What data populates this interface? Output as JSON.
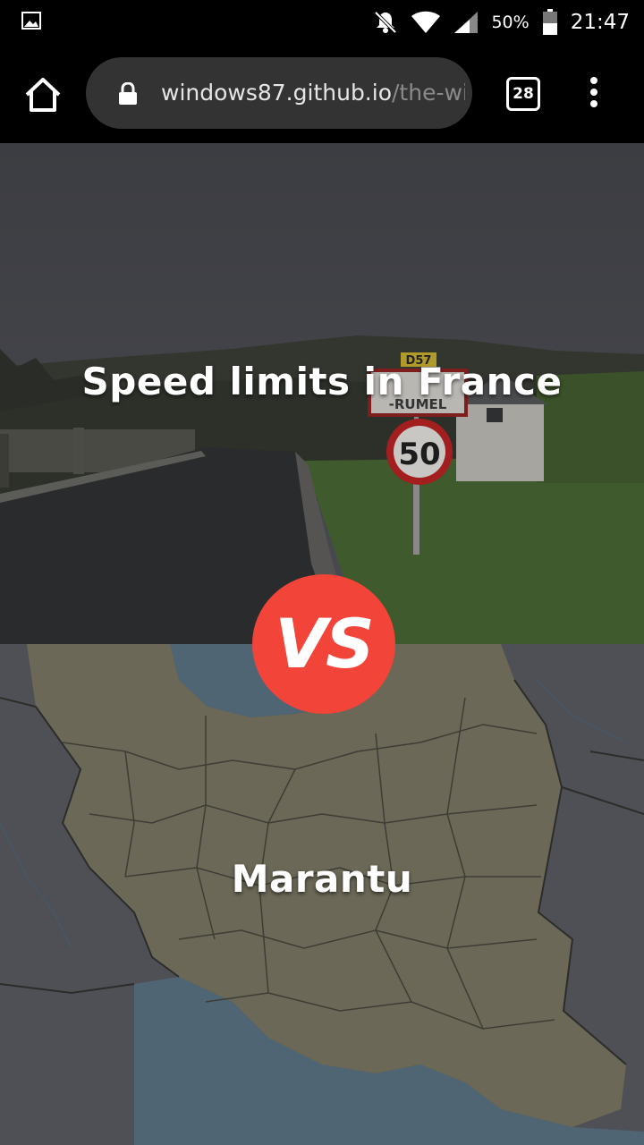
{
  "status_bar": {
    "battery_percent": "50%",
    "time": "21:47",
    "icons": [
      "gallery-icon",
      "notifications-off-icon",
      "wifi-icon",
      "signal-icon",
      "battery-icon"
    ]
  },
  "browser": {
    "url_host": "windows87.github.io",
    "url_path": "/the-wi",
    "tab_count": "28",
    "icons": [
      "home-icon",
      "lock-icon",
      "tabs-icon",
      "overflow-menu-icon"
    ]
  },
  "page": {
    "top_title": "Speed limits in France",
    "top_image": {
      "sign_route": "D57",
      "sign_town": "-RUMEL",
      "speed_limit": "50"
    },
    "vs_label": "VS",
    "bottom_title": "Marantu"
  },
  "colors": {
    "vs_badge": "#f24438",
    "url_bar": "#333333",
    "map_land": "#6b6857",
    "map_water": "#4a5a66"
  }
}
